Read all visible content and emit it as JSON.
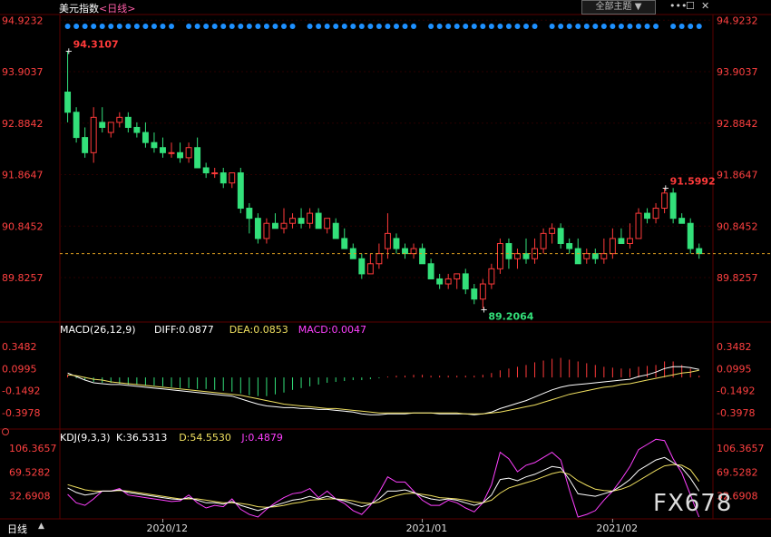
{
  "header": {
    "title": "美元指数",
    "period_label": "<日线>",
    "theme_button": "全部主题",
    "icons": [
      "chevron-down-icon",
      "dots-icon",
      "window-icon",
      "close-icon"
    ]
  },
  "footer": {
    "period": "日线",
    "arrow": "▲"
  },
  "watermark": "FX678",
  "colors": {
    "up": "#ff3a3a",
    "down": "#33e07a",
    "dots": "#1e90ff",
    "dif": "#ffffff",
    "dea": "#f0e060",
    "macd": "#ff40ff",
    "grid": "#5a0000",
    "axis_text": "#ff4040"
  },
  "chart_data": [
    {
      "type": "candlestick",
      "title": "美元指数",
      "period": "日线",
      "y_ticks": [
        "94.9232",
        "93.9037",
        "92.8842",
        "91.8647",
        "90.8452",
        "89.8257"
      ],
      "x_ticks": [
        "2020/12",
        "2021/01",
        "2021/02"
      ],
      "annotations": [
        {
          "label": "94.3107",
          "kind": "high"
        },
        {
          "label": "91.5992",
          "kind": "high"
        },
        {
          "label": "89.2064",
          "kind": "low"
        }
      ],
      "ylim": [
        89.0,
        95.0
      ],
      "candles": [
        [
          93.5,
          94.31,
          92.9,
          93.1
        ],
        [
          93.1,
          93.2,
          92.5,
          92.6
        ],
        [
          92.6,
          92.8,
          92.2,
          92.3
        ],
        [
          92.3,
          93.2,
          92.1,
          93.0
        ],
        [
          92.9,
          93.2,
          92.7,
          92.8
        ],
        [
          92.7,
          92.9,
          92.6,
          92.9
        ],
        [
          92.9,
          93.1,
          92.8,
          93.0
        ],
        [
          93.0,
          93.1,
          92.7,
          92.8
        ],
        [
          92.8,
          92.9,
          92.6,
          92.7
        ],
        [
          92.7,
          92.9,
          92.4,
          92.5
        ],
        [
          92.5,
          92.7,
          92.3,
          92.4
        ],
        [
          92.4,
          92.6,
          92.2,
          92.3
        ],
        [
          92.3,
          92.5,
          92.2,
          92.3
        ],
        [
          92.3,
          92.5,
          92.1,
          92.2
        ],
        [
          92.2,
          92.5,
          92.1,
          92.4
        ],
        [
          92.4,
          92.6,
          92.0,
          92.0
        ],
        [
          92.0,
          92.1,
          91.8,
          91.9
        ],
        [
          91.9,
          92.0,
          91.8,
          91.9
        ],
        [
          91.9,
          92.0,
          91.6,
          91.7
        ],
        [
          91.7,
          91.9,
          91.6,
          91.9
        ],
        [
          91.9,
          92.0,
          91.1,
          91.2
        ],
        [
          91.2,
          91.3,
          90.7,
          91.0
        ],
        [
          91.0,
          91.1,
          90.5,
          90.6
        ],
        [
          90.6,
          91.0,
          90.5,
          90.9
        ],
        [
          90.9,
          91.1,
          90.8,
          90.8
        ],
        [
          90.8,
          91.2,
          90.7,
          90.9
        ],
        [
          90.9,
          91.1,
          90.8,
          91.0
        ],
        [
          91.0,
          91.2,
          90.8,
          90.9
        ],
        [
          90.9,
          91.2,
          90.8,
          91.1
        ],
        [
          91.1,
          91.2,
          90.8,
          90.8
        ],
        [
          90.8,
          91.0,
          90.7,
          91.0
        ],
        [
          90.9,
          91.0,
          90.6,
          90.6
        ],
        [
          90.6,
          90.8,
          90.4,
          90.4
        ],
        [
          90.4,
          90.5,
          90.2,
          90.2
        ],
        [
          90.2,
          90.3,
          89.8,
          89.9
        ],
        [
          89.9,
          90.3,
          89.9,
          90.1
        ],
        [
          90.1,
          90.5,
          90.0,
          90.3
        ],
        [
          90.4,
          91.1,
          90.2,
          90.7
        ],
        [
          90.6,
          90.7,
          90.3,
          90.4
        ],
        [
          90.4,
          90.5,
          90.2,
          90.3
        ],
        [
          90.3,
          90.5,
          90.2,
          90.4
        ],
        [
          90.4,
          90.5,
          90.1,
          90.1
        ],
        [
          90.1,
          90.2,
          89.8,
          89.8
        ],
        [
          89.8,
          89.9,
          89.6,
          89.7
        ],
        [
          89.7,
          89.9,
          89.6,
          89.8
        ],
        [
          89.8,
          89.9,
          89.6,
          89.9
        ],
        [
          89.9,
          90.0,
          89.5,
          89.6
        ],
        [
          89.6,
          89.7,
          89.3,
          89.4
        ],
        [
          89.4,
          89.8,
          89.21,
          89.7
        ],
        [
          89.7,
          90.1,
          89.6,
          90.0
        ],
        [
          90.0,
          90.6,
          89.9,
          90.5
        ],
        [
          90.5,
          90.6,
          90.0,
          90.2
        ],
        [
          90.2,
          90.4,
          90.0,
          90.3
        ],
        [
          90.3,
          90.6,
          90.1,
          90.2
        ],
        [
          90.2,
          90.6,
          90.1,
          90.4
        ],
        [
          90.4,
          90.8,
          90.3,
          90.7
        ],
        [
          90.7,
          90.9,
          90.5,
          90.8
        ],
        [
          90.8,
          90.9,
          90.4,
          90.5
        ],
        [
          90.5,
          90.6,
          90.3,
          90.4
        ],
        [
          90.4,
          90.6,
          90.1,
          90.1
        ],
        [
          90.2,
          90.4,
          90.1,
          90.3
        ],
        [
          90.3,
          90.4,
          90.1,
          90.2
        ],
        [
          90.2,
          90.6,
          90.1,
          90.3
        ],
        [
          90.3,
          90.8,
          90.2,
          90.6
        ],
        [
          90.6,
          90.8,
          90.5,
          90.5
        ],
        [
          90.5,
          90.9,
          90.4,
          90.6
        ],
        [
          90.6,
          91.2,
          90.6,
          91.1
        ],
        [
          91.1,
          91.2,
          90.9,
          91.0
        ],
        [
          91.0,
          91.3,
          90.9,
          91.2
        ],
        [
          91.2,
          91.6,
          91.1,
          91.5
        ],
        [
          91.5,
          91.6,
          90.9,
          91.0
        ],
        [
          91.0,
          91.1,
          90.9,
          90.9
        ],
        [
          90.9,
          91.0,
          90.3,
          90.4
        ],
        [
          90.4,
          90.5,
          90.2,
          90.3
        ]
      ]
    },
    {
      "type": "line",
      "indicator": "MACD",
      "params_label": "MACD(26,12,9)",
      "legend": [
        {
          "label": "DIFF:0.0877",
          "color_key": "dif"
        },
        {
          "label": "DEA:0.0853",
          "color_key": "dea"
        },
        {
          "label": "MACD:0.0047",
          "color_key": "macd"
        }
      ],
      "y_ticks": [
        "0.3482",
        "0.0995",
        "-0.1492",
        "-0.3978"
      ],
      "ylim": [
        -0.55,
        0.45
      ],
      "dif": [
        0.05,
        0.01,
        -0.03,
        -0.06,
        -0.07,
        -0.08,
        -0.08,
        -0.09,
        -0.1,
        -0.11,
        -0.12,
        -0.13,
        -0.14,
        -0.15,
        -0.16,
        -0.17,
        -0.18,
        -0.19,
        -0.2,
        -0.21,
        -0.24,
        -0.27,
        -0.3,
        -0.32,
        -0.33,
        -0.34,
        -0.34,
        -0.35,
        -0.35,
        -0.36,
        -0.36,
        -0.37,
        -0.38,
        -0.39,
        -0.41,
        -0.42,
        -0.42,
        -0.41,
        -0.41,
        -0.41,
        -0.4,
        -0.4,
        -0.4,
        -0.41,
        -0.41,
        -0.41,
        -0.41,
        -0.42,
        -0.41,
        -0.39,
        -0.35,
        -0.32,
        -0.29,
        -0.26,
        -0.22,
        -0.18,
        -0.14,
        -0.11,
        -0.09,
        -0.08,
        -0.07,
        -0.06,
        -0.05,
        -0.04,
        -0.03,
        -0.02,
        0.01,
        0.03,
        0.06,
        0.1,
        0.12,
        0.12,
        0.11,
        0.09
      ],
      "dea": [
        0.03,
        0.02,
        0.0,
        -0.02,
        -0.03,
        -0.05,
        -0.06,
        -0.07,
        -0.08,
        -0.09,
        -0.1,
        -0.11,
        -0.12,
        -0.13,
        -0.14,
        -0.15,
        -0.16,
        -0.17,
        -0.18,
        -0.19,
        -0.2,
        -0.22,
        -0.24,
        -0.26,
        -0.28,
        -0.3,
        -0.31,
        -0.32,
        -0.33,
        -0.34,
        -0.35,
        -0.35,
        -0.36,
        -0.37,
        -0.38,
        -0.39,
        -0.4,
        -0.4,
        -0.4,
        -0.4,
        -0.4,
        -0.4,
        -0.4,
        -0.4,
        -0.4,
        -0.4,
        -0.41,
        -0.41,
        -0.41,
        -0.4,
        -0.39,
        -0.37,
        -0.35,
        -0.33,
        -0.31,
        -0.28,
        -0.25,
        -0.22,
        -0.19,
        -0.17,
        -0.15,
        -0.13,
        -0.11,
        -0.1,
        -0.08,
        -0.07,
        -0.05,
        -0.03,
        -0.01,
        0.01,
        0.03,
        0.05,
        0.06,
        0.08
      ],
      "macd": [
        0.03,
        -0.01,
        -0.03,
        -0.05,
        -0.06,
        -0.06,
        -0.07,
        -0.08,
        -0.08,
        -0.09,
        -0.09,
        -0.1,
        -0.11,
        -0.12,
        -0.12,
        -0.13,
        -0.13,
        -0.14,
        -0.15,
        -0.16,
        -0.18,
        -0.2,
        -0.21,
        -0.21,
        -0.19,
        -0.17,
        -0.14,
        -0.12,
        -0.1,
        -0.08,
        -0.06,
        -0.05,
        -0.04,
        -0.03,
        -0.03,
        -0.02,
        -0.01,
        0.01,
        0.02,
        0.02,
        0.03,
        0.03,
        0.02,
        0.02,
        0.02,
        0.02,
        0.02,
        0.02,
        0.03,
        0.05,
        0.08,
        0.1,
        0.12,
        0.14,
        0.17,
        0.19,
        0.21,
        0.22,
        0.2,
        0.18,
        0.16,
        0.14,
        0.12,
        0.11,
        0.1,
        0.1,
        0.12,
        0.13,
        0.14,
        0.18,
        0.18,
        0.14,
        0.1,
        0.02
      ]
    },
    {
      "type": "line",
      "indicator": "KDJ",
      "params_label": "KDJ(9,3,3)",
      "legend": [
        {
          "label": "K:36.5313",
          "color_key": "dif"
        },
        {
          "label": "D:54.5530",
          "color_key": "dea"
        },
        {
          "label": "J:0.4879",
          "color_key": "macd"
        }
      ],
      "y_ticks": [
        "106.3657",
        "69.5282",
        "32.6908"
      ],
      "ylim": [
        0,
        112
      ],
      "k": [
        45,
        38,
        34,
        36,
        40,
        40,
        42,
        38,
        36,
        34,
        32,
        30,
        28,
        27,
        30,
        26,
        22,
        22,
        20,
        24,
        18,
        14,
        10,
        14,
        18,
        22,
        26,
        28,
        32,
        28,
        32,
        28,
        25,
        20,
        16,
        20,
        28,
        40,
        40,
        42,
        38,
        32,
        28,
        26,
        28,
        26,
        22,
        18,
        22,
        34,
        58,
        60,
        56,
        62,
        66,
        72,
        78,
        76,
        58,
        36,
        34,
        32,
        36,
        40,
        48,
        58,
        72,
        80,
        88,
        92,
        84,
        76,
        60,
        40
      ],
      "d": [
        50,
        46,
        42,
        40,
        40,
        40,
        41,
        40,
        38,
        36,
        34,
        32,
        30,
        28,
        28,
        28,
        26,
        24,
        22,
        22,
        21,
        19,
        16,
        15,
        16,
        18,
        21,
        23,
        26,
        27,
        28,
        28,
        27,
        25,
        22,
        21,
        23,
        29,
        33,
        36,
        37,
        35,
        33,
        30,
        29,
        28,
        26,
        23,
        22,
        26,
        37,
        45,
        49,
        53,
        57,
        62,
        67,
        70,
        66,
        56,
        49,
        43,
        41,
        40,
        43,
        48,
        56,
        64,
        72,
        79,
        81,
        80,
        73,
        55
      ],
      "j": [
        35,
        22,
        18,
        28,
        40,
        40,
        44,
        34,
        32,
        30,
        28,
        26,
        24,
        25,
        34,
        22,
        14,
        18,
        16,
        28,
        12,
        4,
        0,
        12,
        22,
        30,
        36,
        38,
        44,
        30,
        40,
        28,
        21,
        10,
        4,
        18,
        38,
        62,
        54,
        54,
        40,
        26,
        18,
        18,
        26,
        22,
        14,
        8,
        22,
        50,
        100,
        90,
        70,
        80,
        84,
        92,
        100,
        88,
        42,
        0,
        4,
        10,
        26,
        40,
        58,
        78,
        104,
        112,
        120,
        118,
        90,
        68,
        34,
        0
      ]
    }
  ]
}
